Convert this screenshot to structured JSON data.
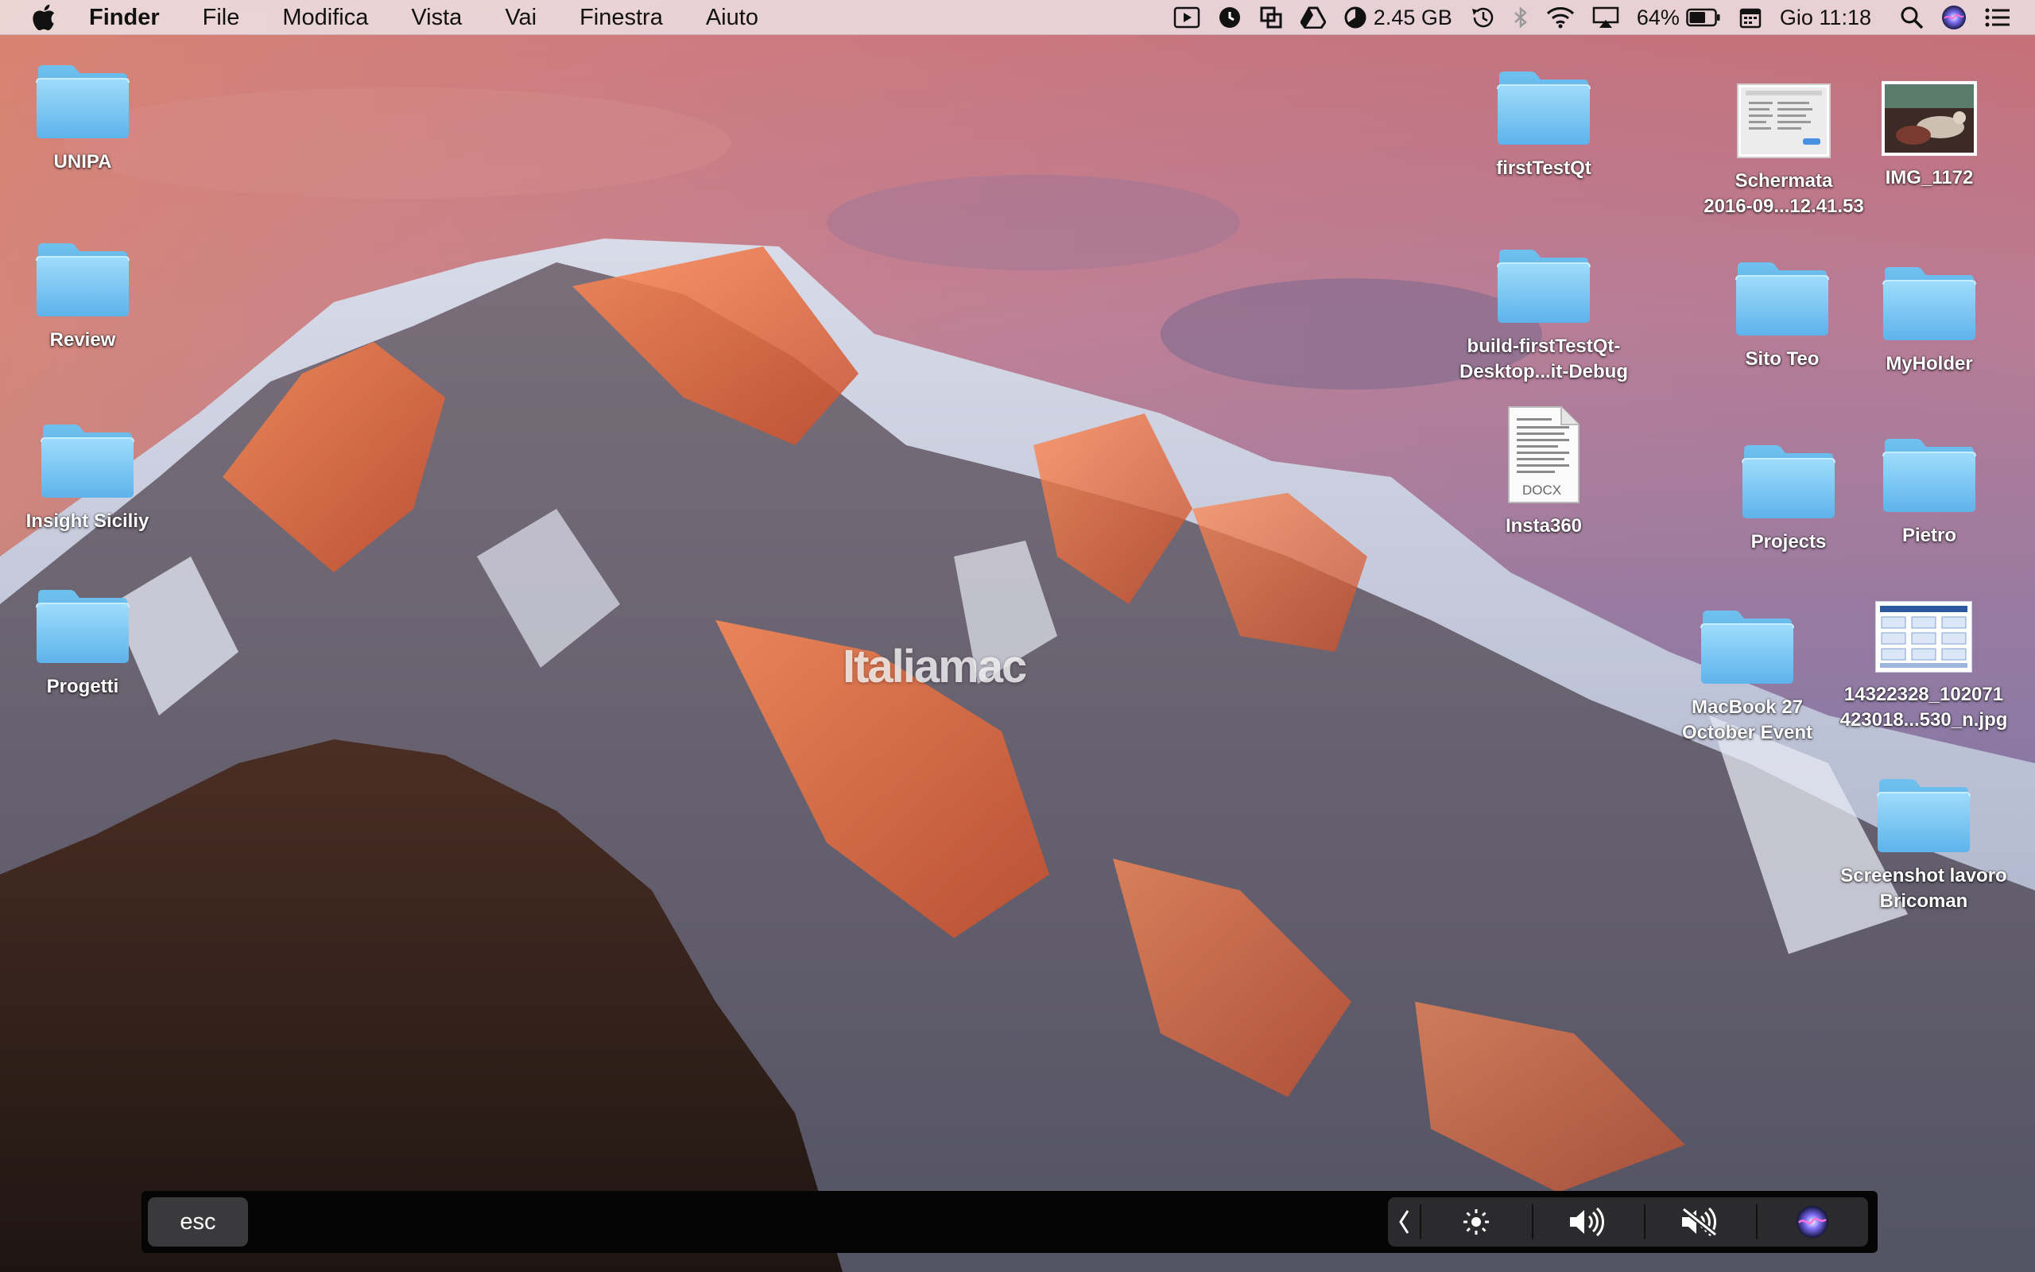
{
  "menubar": {
    "app_name": "Finder",
    "menus": [
      "File",
      "Modifica",
      "Vista",
      "Vai",
      "Finestra",
      "Aiuto"
    ],
    "memory": "2.45 GB",
    "battery_percent": "64%",
    "battery_level": 0.64,
    "clock": "Gio 11:18",
    "status_icons": [
      "video-play-icon",
      "clock-app-icon",
      "screenshot-tool-icon",
      "google-drive-icon",
      "memory-monitor-icon",
      "time-machine-icon",
      "bluetooth-icon",
      "wifi-icon",
      "airplay-icon",
      "battery-icon",
      "calendar-icon",
      "spotlight-search-icon",
      "siri-icon",
      "notification-center-icon"
    ]
  },
  "desktop": {
    "left_items": [
      {
        "label": "UNIPA",
        "kind": "folder"
      },
      {
        "label": "Review",
        "kind": "folder"
      },
      {
        "label": "Insight Siciliy",
        "kind": "folder"
      },
      {
        "label": "Progetti",
        "kind": "folder"
      }
    ],
    "right_items": [
      {
        "label": "firstTestQt",
        "kind": "folder"
      },
      {
        "label": "build-firstTestQt-",
        "label2": "Desktop...it-Debug",
        "kind": "folder"
      },
      {
        "label": "Insta360",
        "kind": "docx",
        "badge": "DOCX"
      },
      {
        "label": "Schermata",
        "label2": "2016-09...12.41.53",
        "kind": "screenshot"
      },
      {
        "label": "IMG_1172",
        "kind": "photo"
      },
      {
        "label": "Sito Teo",
        "kind": "folder"
      },
      {
        "label": "MyHolder",
        "kind": "folder"
      },
      {
        "label": "Projects",
        "kind": "folder"
      },
      {
        "label": "Pietro",
        "kind": "folder"
      },
      {
        "label": "MacBook 27",
        "label2": "October Event",
        "kind": "folder"
      },
      {
        "label": "14322328_102071",
        "label2": "423018...530_n.jpg",
        "kind": "image"
      },
      {
        "label": "Screenshot lavoro",
        "label2": "Bricoman",
        "kind": "folder"
      }
    ]
  },
  "watermark": "Italiamac",
  "touchbar": {
    "esc_label": "esc",
    "controls": [
      "collapse-chevron-icon",
      "brightness-icon",
      "volume-icon",
      "mute-icon",
      "siri-icon"
    ]
  },
  "colors": {
    "folder_top": "#8ed3f7",
    "folder_bottom": "#5fb6ec",
    "menubar_bg": "#f0e8ec",
    "touchbar_bg": "#050505"
  }
}
